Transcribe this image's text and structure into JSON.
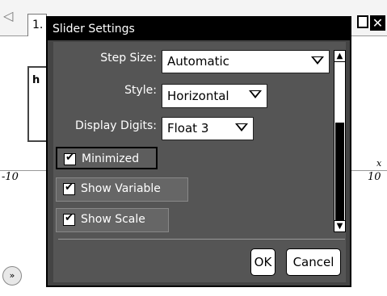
{
  "tab": {
    "left_arrow": "◁",
    "label": "1."
  },
  "window_icons": {
    "pin": "pin-icon",
    "close": "close-icon",
    "close_glyph": "✕"
  },
  "background": {
    "box_letter": "h",
    "axis_left": "-10",
    "axis_right": "10",
    "axis_var": "x",
    "nav_glyph": "»"
  },
  "dialog": {
    "title": "Slider Settings",
    "fields": {
      "step_size": {
        "label": "Step Size:",
        "value": "Automatic"
      },
      "style": {
        "label": "Style:",
        "value": "Horizontal"
      },
      "display_digits": {
        "label": "Display Digits:",
        "value": "Float 3"
      }
    },
    "checkboxes": {
      "minimized": "Minimized",
      "show_variable": "Show Variable",
      "show_scale": "Show Scale"
    },
    "scrollbar": {
      "up": "▲",
      "down": "▼"
    },
    "buttons": {
      "ok": "OK",
      "cancel": "Cancel"
    }
  }
}
